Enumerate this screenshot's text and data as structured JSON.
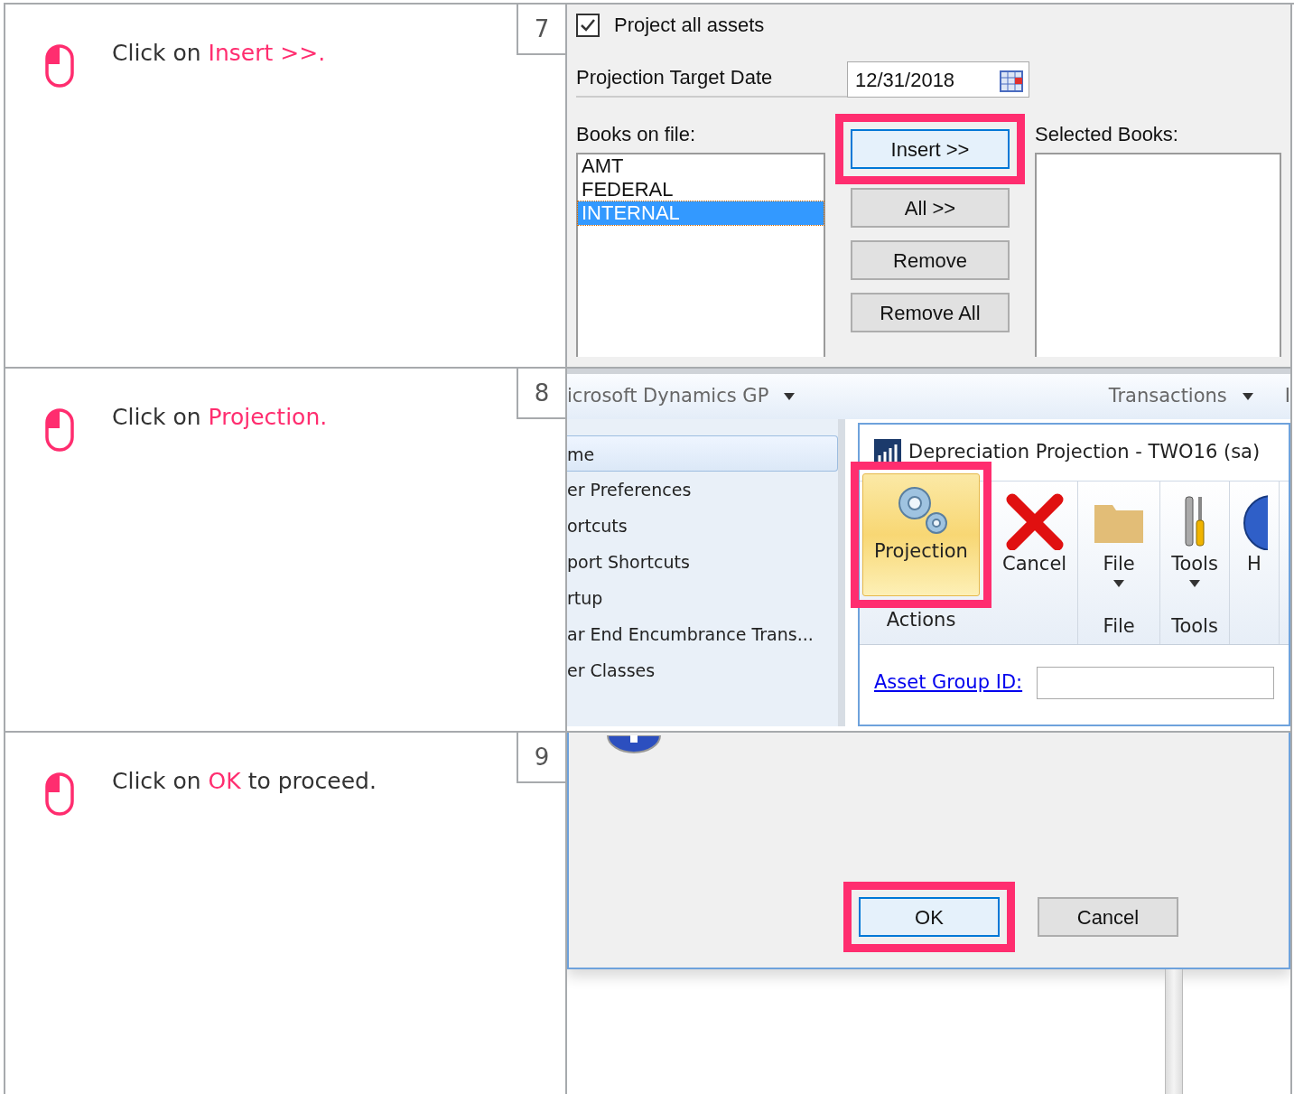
{
  "steps": [
    {
      "number": "7",
      "instruction": {
        "before": "Click on ",
        "highlight": "Insert >>."
      },
      "screenshot": {
        "kind": "books_dialog",
        "checkbox": {
          "label": "Project all assets",
          "checked": true
        },
        "date": {
          "label": "Projection Target Date",
          "value": "12/31/2018"
        },
        "books_label": "Books on file:",
        "books": [
          {
            "name": "AMT",
            "selected": false
          },
          {
            "name": "FEDERAL",
            "selected": false
          },
          {
            "name": "INTERNAL",
            "selected": true
          }
        ],
        "selected_label": "Selected Books:",
        "buttons": [
          {
            "label": "Insert >>",
            "highlighted": true
          },
          {
            "label": "All >>",
            "highlighted": false
          },
          {
            "label": "Remove",
            "highlighted": false
          },
          {
            "label": "Remove All",
            "highlighted": false
          }
        ]
      }
    },
    {
      "number": "8",
      "instruction": {
        "before": "Click on ",
        "highlight": "Projection."
      },
      "screenshot": {
        "kind": "ribbon_window",
        "menus": [
          "icrosoft Dynamics GP",
          "Transactions",
          "I"
        ],
        "nav": [
          {
            "label": "me",
            "selected": true
          },
          {
            "label": "er Preferences",
            "selected": false
          },
          {
            "label": "ortcuts",
            "selected": false
          },
          {
            "label": "port Shortcuts",
            "selected": false
          },
          {
            "label": "rtup",
            "selected": false
          },
          {
            "label": "ar End Encumbrance Trans...",
            "selected": false
          },
          {
            "label": "er Classes",
            "selected": false
          }
        ],
        "window_title": "Depreciation Projection  -  TWO16 (sa)",
        "ribbon": [
          {
            "label": "Projection",
            "dropdown": false,
            "highlighted": true
          },
          {
            "label": "Cancel",
            "dropdown": false,
            "highlighted": false
          },
          {
            "label": "File",
            "dropdown": true,
            "highlighted": false
          },
          {
            "label": "Tools",
            "dropdown": true,
            "highlighted": false
          },
          {
            "label": "H",
            "dropdown": false,
            "highlighted": false
          }
        ],
        "groups": [
          "Actions",
          "File",
          "Tools"
        ],
        "link": "Asset Group ID:"
      }
    },
    {
      "number": "9",
      "instruction": {
        "before": "Click on ",
        "highlight": "OK",
        "after": " to proceed."
      },
      "screenshot": {
        "kind": "confirm_dialog",
        "buttons": [
          {
            "label": "OK",
            "highlighted": true
          },
          {
            "label": "Cancel",
            "highlighted": false
          }
        ]
      }
    }
  ]
}
